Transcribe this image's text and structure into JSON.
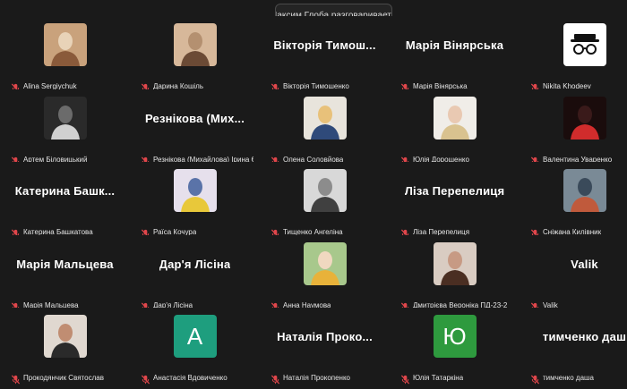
{
  "notification": "Максим Глоба разговаривает...",
  "colors": {
    "background": "#1a1a1a",
    "muted_mic": "#e0464b",
    "label_text": "#e6e6e6"
  },
  "participants": [
    {
      "name": "Alina Sergiychuk",
      "display": "photo",
      "photo": [
        "#c9a27c",
        "#8a5a3a",
        "#e8d3b8"
      ]
    },
    {
      "name": "Дарина Кошіль",
      "display": "photo",
      "photo": [
        "#d7b89a",
        "#6b4a35",
        "#b49070"
      ]
    },
    {
      "name": "Вікторія Тимошенко",
      "display": "name",
      "big_name": "Вікторія Тимош..."
    },
    {
      "name": "Марія Вінярська",
      "display": "name",
      "big_name": "Марія Вінярська"
    },
    {
      "name": "Nikita Khodeev",
      "display": "icon",
      "icon": "incognito-icon"
    },
    {
      "name": "Артем Біловицький",
      "display": "photo",
      "photo": [
        "#2a2a2a",
        "#d0d0d0",
        "#6b6b6b"
      ]
    },
    {
      "name": "Резнікова (Михайлова) Ірина Євгені...",
      "display": "name",
      "big_name": "Резнікова (Мих..."
    },
    {
      "name": "Олена Соловйова",
      "display": "photo",
      "photo": [
        "#e8e4dc",
        "#2f4a7a",
        "#e8c17a"
      ]
    },
    {
      "name": "Юлія Дорошенко",
      "display": "photo",
      "photo": [
        "#f0ede8",
        "#d9c28f",
        "#e9c9b2"
      ]
    },
    {
      "name": "Валентина Уваренко",
      "display": "photo",
      "photo": [
        "#1a0c0c",
        "#d12c2c",
        "#3a1a1a"
      ]
    },
    {
      "name": "Катерина Башкатова",
      "display": "name",
      "big_name": "Катерина  Башк..."
    },
    {
      "name": "Раїса Кочура",
      "display": "photo",
      "photo": [
        "#e6e0ec",
        "#e8c83a",
        "#5a73a8"
      ]
    },
    {
      "name": "Тищенко Ангеліна",
      "display": "photo",
      "photo": [
        "#d8d8d8",
        "#404040",
        "#8c8c8c"
      ]
    },
    {
      "name": "Ліза Перепелиця",
      "display": "name",
      "big_name": "Ліза Перепелиця"
    },
    {
      "name": "Сніжана Килівник",
      "display": "photo",
      "photo": [
        "#7a8a96",
        "#c05a3c",
        "#3a4a5a"
      ]
    },
    {
      "name": "Марія Мальцева",
      "display": "name",
      "big_name": "Марія Мальцева"
    },
    {
      "name": "Дар'я Лісіна",
      "display": "name",
      "big_name": "Дар'я Лісіна"
    },
    {
      "name": "Анна Наумова",
      "display": "photo",
      "photo": [
        "#a8c88c",
        "#e8b23a",
        "#f0d8c0"
      ]
    },
    {
      "name": "Дмитрієва Вероніка ПД-23-2",
      "display": "photo",
      "photo": [
        "#d9ccc2",
        "#4a2e22",
        "#c79a84"
      ]
    },
    {
      "name": "Valik",
      "display": "name",
      "big_name": "Valik"
    },
    {
      "name": "Прокодянчик Святослав",
      "display": "photo",
      "photo": [
        "#e0d8d0",
        "#2a2a2a",
        "#c08d72"
      ]
    },
    {
      "name": "Анастасія Вдовиченко",
      "display": "letter",
      "letter": "A",
      "letter_bg": "#1e9e7e"
    },
    {
      "name": "Наталія Прокопенко",
      "display": "name",
      "big_name": "Наталія  Проко..."
    },
    {
      "name": "Юлія Татаркіна",
      "display": "letter",
      "letter": "Ю",
      "letter_bg": "#2e9a3e"
    },
    {
      "name": "тимченко даша",
      "display": "name",
      "big_name": "тимченко даш"
    }
  ]
}
